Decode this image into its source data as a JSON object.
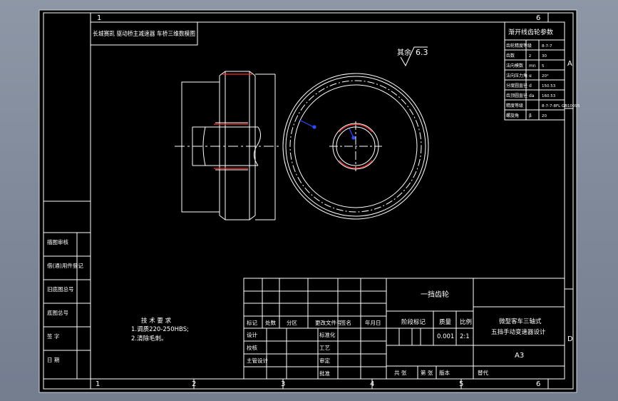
{
  "drawing": {
    "header_note": "长城赛凯 驱动桥主减速器 车桥三维数模图",
    "roughness": "其余",
    "roughness_value": "6.3",
    "zone_numbers_top": [
      "1",
      "6"
    ],
    "zone_numbers_bottom": [
      "1",
      "2",
      "3",
      "4",
      "5",
      "6"
    ],
    "zone_letters_right": [
      "A",
      "D"
    ],
    "colors": {
      "sheet": "#000000",
      "line": "#ffffff",
      "highlight_red": "#ff2a2a",
      "leader_blue": "#2f4bff",
      "background": "#7e8898"
    }
  },
  "gear_params": {
    "title": "渐开线齿轮参数",
    "rows": [
      {
        "name": "齿轮精度等级",
        "symbol": "",
        "value": "8-7-7"
      },
      {
        "name": "齿数",
        "symbol": "z",
        "value": "30"
      },
      {
        "name": "法向模数",
        "symbol": "mn",
        "value": "5"
      },
      {
        "name": "法向压力角",
        "symbol": "α",
        "value": "20°"
      },
      {
        "name": "分度圆直径",
        "symbol": "d",
        "value": "150.53"
      },
      {
        "name": "齿顶圆直径",
        "symbol": "da",
        "value": "160.53"
      },
      {
        "name": "精度等级",
        "symbol": "",
        "value": "8-7-7-8FL GB10095"
      },
      {
        "name": "螺旋角",
        "symbol": "β",
        "value": "20"
      }
    ]
  },
  "side_panel": {
    "items": [
      "借(通)用件登记",
      "旧底图总号",
      "底图总号",
      "签  字",
      "日  期"
    ],
    "top_label": "描图审核"
  },
  "tech_req": {
    "title": "技 术 要 求",
    "lines": [
      "1.调质220-250HBS;",
      "2.清除毛刺。"
    ]
  },
  "title_block": {
    "part_name": "一挡齿轮",
    "project_line1": "微型客车三轴式",
    "project_line2": "五挡手动变速器设计",
    "sheet_size": "A3",
    "mark_label": "阶段标记",
    "weight_label": "质量",
    "scale_label": "比例",
    "weight_value": "0.001",
    "scale_value": "2:1",
    "rev_headers": [
      "标记",
      "处数",
      "分区",
      "更改文件号",
      "签名",
      "年月日"
    ],
    "roles": [
      "设计",
      "校核",
      "主管设计",
      "标准化",
      "工艺",
      "审定",
      "批准"
    ],
    "footer": [
      "共 张",
      "第 张",
      "版本",
      "替代"
    ]
  }
}
